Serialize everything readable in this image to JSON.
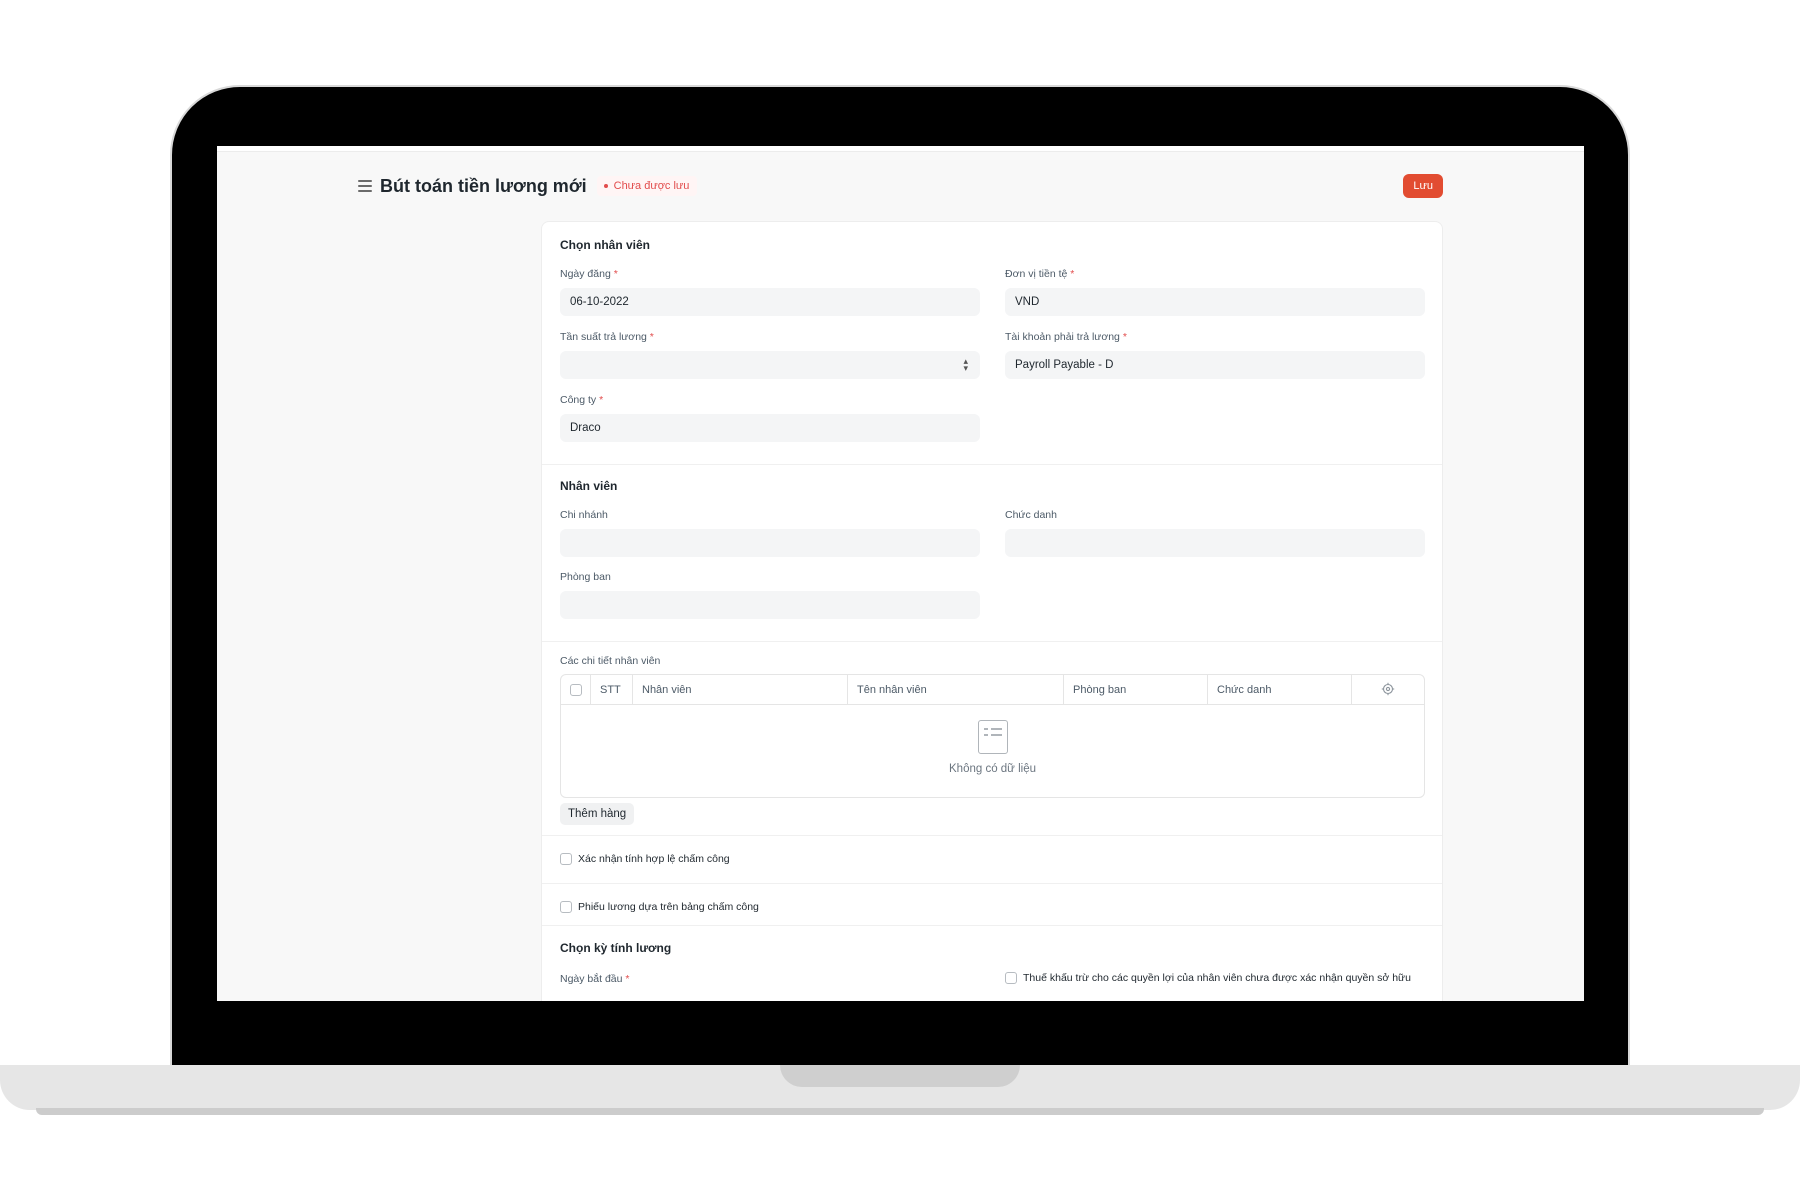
{
  "header": {
    "title": "Bút toán tiền lương mới",
    "status": "Chưa được lưu",
    "save_label": "Lưu"
  },
  "section_select_employee": {
    "title": "Chọn nhân viên",
    "posting_date": {
      "label": "Ngày đăng",
      "value": "06-10-2022"
    },
    "currency": {
      "label": "Đơn vị tiền tệ",
      "value": "VND"
    },
    "payroll_frequency": {
      "label": "Tần suất trả lương",
      "value": ""
    },
    "payable_account": {
      "label": "Tài khoản phải trả lương",
      "value": "Payroll Payable - D"
    },
    "company": {
      "label": "Công ty",
      "value": "Draco"
    }
  },
  "section_employees": {
    "title": "Nhân viên",
    "branch": {
      "label": "Chi nhánh",
      "value": ""
    },
    "designation": {
      "label": "Chức danh",
      "value": ""
    },
    "department": {
      "label": "Phòng ban",
      "value": ""
    }
  },
  "employee_details": {
    "label": "Các chi tiết nhân viên",
    "columns": [
      "STT",
      "Nhân viên",
      "Tên nhân viên",
      "Phòng ban",
      "Chức danh"
    ],
    "empty_text": "Không có dữ liệu",
    "add_row_label": "Thêm hàng"
  },
  "checks": {
    "validate_attendance": "Xác nhận tính hợp lệ chấm công",
    "salary_slip_timesheet": "Phiếu lương dựa trên bảng chấm công"
  },
  "section_payroll_period": {
    "title": "Chọn kỳ tính lương",
    "start_date": {
      "label": "Ngày bắt đầu"
    },
    "deduct_tax_label": "Thuế khấu trừ cho các quyền lợi của nhân viên chưa được xác nhận quyền sở hữu"
  },
  "required_marker": "*"
}
